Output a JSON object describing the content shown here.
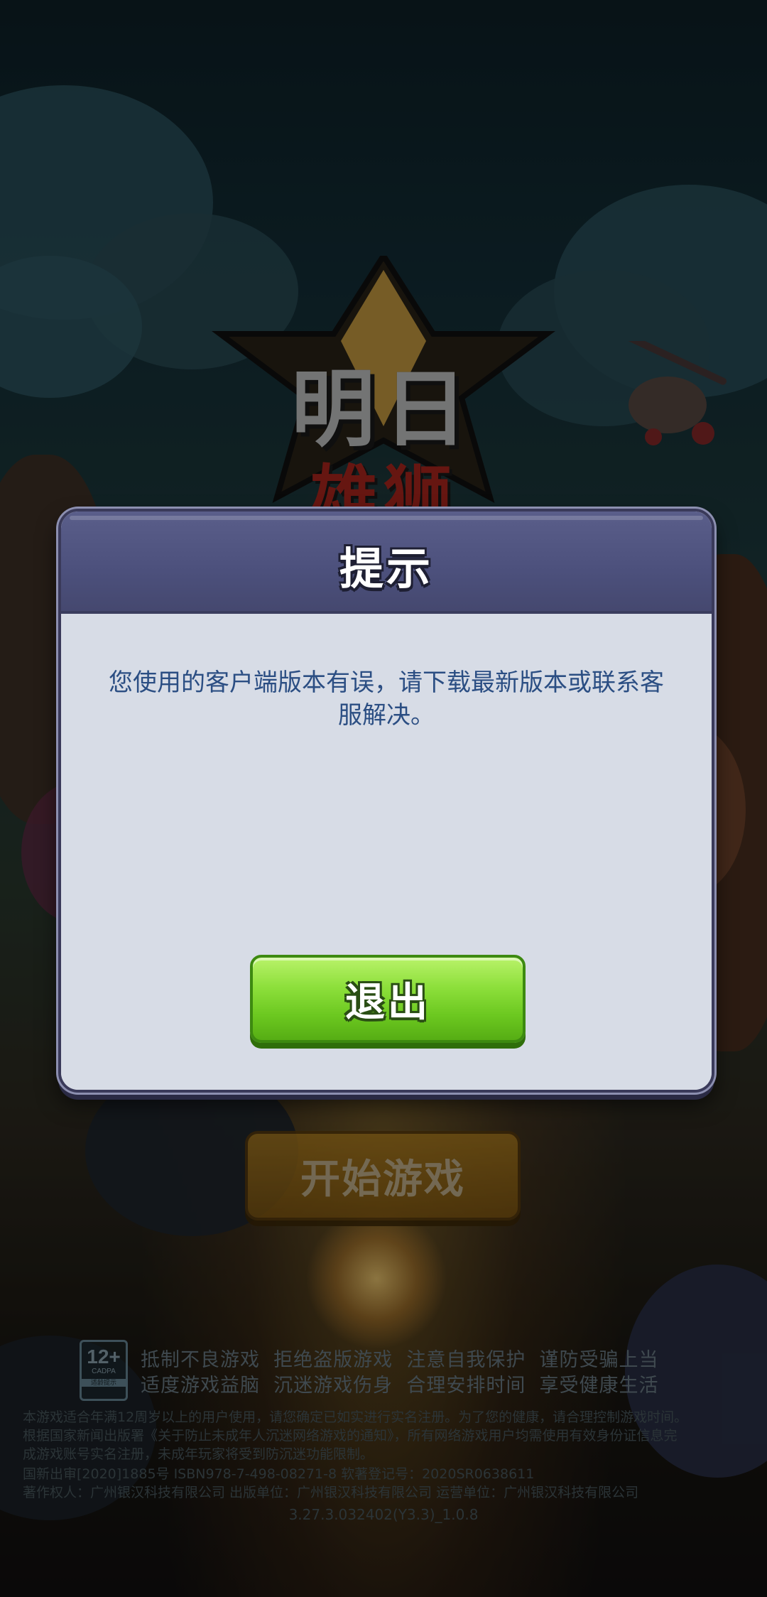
{
  "background": {
    "logo": {
      "line1": "明日",
      "line2": "雄狮"
    },
    "start_button_label": "开始游戏"
  },
  "dialog": {
    "title": "提示",
    "message": "您使用的客户端版本有误，请下载最新版本或联系客服解决。",
    "exit_button_label": "退出"
  },
  "footer": {
    "age_rating": {
      "number": "12+",
      "org": "CADPA",
      "caption": "适龄提示"
    },
    "health_notice": {
      "line1": "抵制不良游戏  拒绝盗版游戏  注意自我保护  谨防受骗上当",
      "line2": "适度游戏益脑  沉迷游戏伤身  合理安排时间  享受健康生活"
    },
    "legal": [
      "本游戏适合年满12周岁以上的用户使用，请您确定已如实进行实名注册。为了您的健康，请合理控制游戏时间。",
      "根据国家新闻出版署《关于防止未成年人沉迷网络游戏的通知》，所有网络游戏用户均需使用有效身份证信息完",
      "成游戏账号实名注册，未成年玩家将受到防沉迷功能限制。",
      "国新出审[2020]1885号   ISBN978-7-498-08271-8   软著登记号：2020SR0638611",
      "著作权人：广州银汉科技有限公司 出版单位：广州银汉科技有限公司 运营单位：广州银汉科技有限公司"
    ],
    "version": "3.27.3.032402(Y3.3)_1.0.8"
  },
  "colors": {
    "dialog_header": "#4c507c",
    "dialog_body": "#d7dce6",
    "message_text": "#2b4e83",
    "exit_button": "#8ee03c"
  }
}
